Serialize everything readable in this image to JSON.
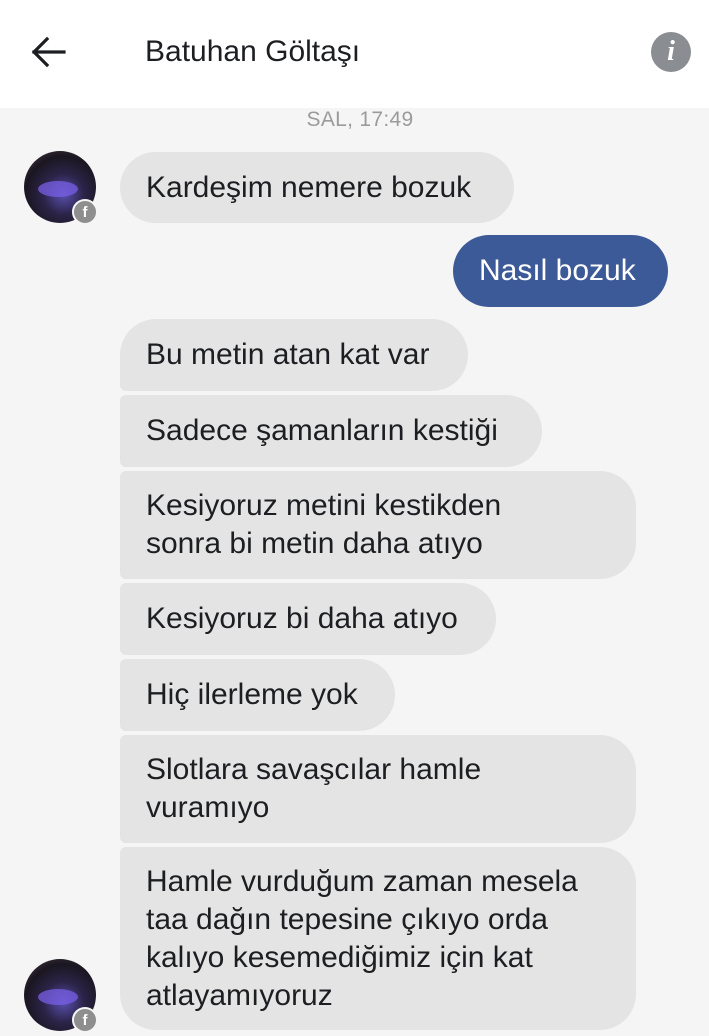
{
  "header": {
    "contact_name": "Batuhan Göltaşı",
    "back_icon": "arrow-left-icon",
    "info_icon": "info-icon",
    "info_glyph": "i"
  },
  "thread": {
    "timestamp": "SAL, 17:49",
    "messages": [
      {
        "direction": "in",
        "text": "Kardeşim nemere bozuk"
      },
      {
        "direction": "out",
        "text": "Nasıl bozuk"
      },
      {
        "direction": "in",
        "text": "Bu metin atan kat var"
      },
      {
        "direction": "in",
        "text": "Sadece şamanların kestiği"
      },
      {
        "direction": "in",
        "text": "Kesiyoruz metini kestikden\nsonra bi metin daha atıyo"
      },
      {
        "direction": "in",
        "text": "Kesiyoruz bi daha atıyo"
      },
      {
        "direction": "in",
        "text": "Hiç ilerleme yok"
      },
      {
        "direction": "in",
        "text": "Slotlara savaşcılar hamle\nvuramıyo"
      },
      {
        "direction": "in",
        "text": "Hamle vurduğum zaman mesela\ntaa dağın tepesine çıkıyo orda\nkalıyo kesemediğimiz için kat\natlayamıyoruz"
      }
    ]
  },
  "badge": {
    "icon": "facebook-badge-icon",
    "glyph": "f"
  },
  "colors": {
    "outgoing_bubble": "#3d5a98",
    "incoming_bubble": "#e4e4e4",
    "background": "#f5f5f5"
  }
}
